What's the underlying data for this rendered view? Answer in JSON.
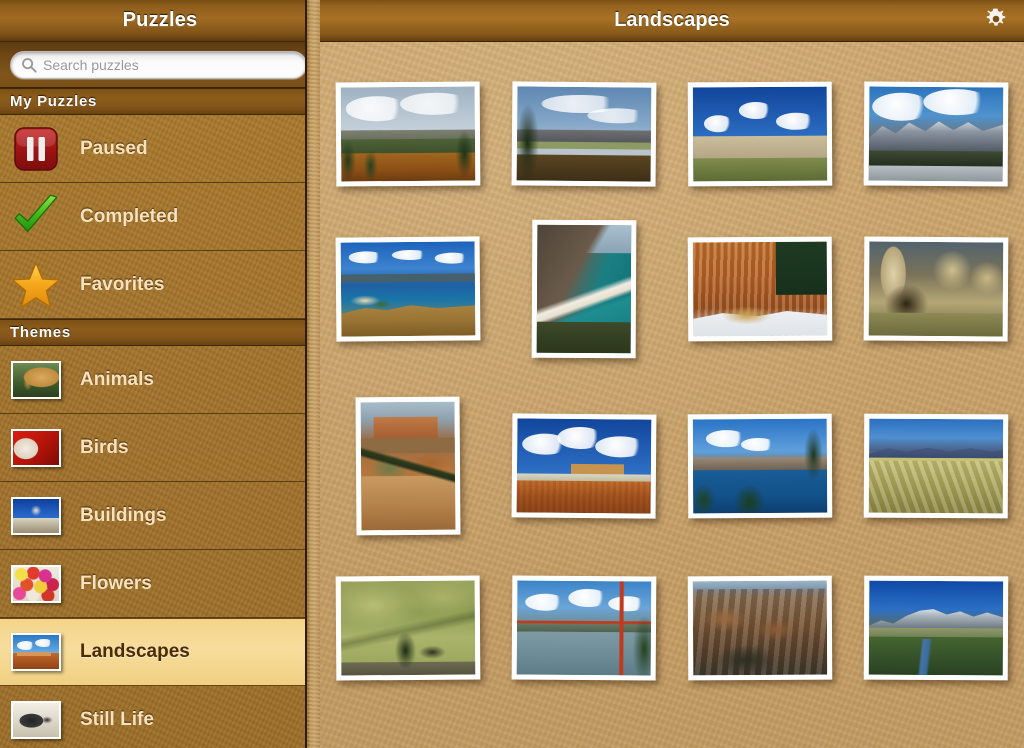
{
  "sidebar": {
    "title": "Puzzles",
    "search": {
      "placeholder": "Search puzzles",
      "value": "",
      "icon": "search-icon"
    },
    "sections": [
      {
        "header": "My Puzzles",
        "items": [
          {
            "label": "Paused",
            "icon": "pause-icon",
            "selected": false
          },
          {
            "label": "Completed",
            "icon": "checkmark-icon",
            "selected": false
          },
          {
            "label": "Favorites",
            "icon": "star-icon",
            "selected": false
          }
        ]
      },
      {
        "header": "Themes",
        "items": [
          {
            "label": "Animals",
            "icon": "thumbnail-giraffe",
            "selected": false
          },
          {
            "label": "Birds",
            "icon": "thumbnail-parrot",
            "selected": false
          },
          {
            "label": "Buildings",
            "icon": "thumbnail-building",
            "selected": false
          },
          {
            "label": "Flowers",
            "icon": "thumbnail-flowers",
            "selected": false
          },
          {
            "label": "Landscapes",
            "icon": "thumbnail-mesa",
            "selected": true
          },
          {
            "label": "Still Life",
            "icon": "thumbnail-fish",
            "selected": false
          }
        ]
      }
    ]
  },
  "main": {
    "title": "Landscapes",
    "settings_button": {
      "icon": "gear-icon",
      "label": "Settings"
    },
    "grid": {
      "rows": [
        [
          {
            "name": "autumn-valley-conifers",
            "orientation": "landscape"
          },
          {
            "name": "river-valley-mountains",
            "orientation": "landscape"
          },
          {
            "name": "badlands-blue-sky",
            "orientation": "landscape"
          },
          {
            "name": "snow-peaks-alpine-lake",
            "orientation": "landscape"
          }
        ],
        [
          {
            "name": "island-bay-aerial",
            "orientation": "landscape"
          },
          {
            "name": "coastal-cliffs-beach",
            "orientation": "portrait"
          },
          {
            "name": "bryce-canyon-hoodoos",
            "orientation": "landscape"
          },
          {
            "name": "desert-rock-spires",
            "orientation": "landscape"
          }
        ],
        [
          {
            "name": "canyon-mesa-tree",
            "orientation": "portrait"
          },
          {
            "name": "red-butte-clouds",
            "orientation": "landscape"
          },
          {
            "name": "crater-lake",
            "orientation": "landscape"
          },
          {
            "name": "badlands-ridge-range",
            "orientation": "landscape"
          }
        ],
        [
          {
            "name": "green-rolling-hills",
            "orientation": "landscape"
          },
          {
            "name": "golden-gate-bridge",
            "orientation": "landscape"
          },
          {
            "name": "grand-canyon-layers",
            "orientation": "landscape"
          },
          {
            "name": "grand-tetons-river",
            "orientation": "landscape"
          }
        ]
      ]
    }
  },
  "colors": {
    "sidebar_bg": "#a2722a",
    "main_bg": "#c9a36b",
    "titlebar": "#a87125",
    "selection": "#f3d489",
    "label_text": "#f6e2bd",
    "selected_text": "#4a2c0b"
  }
}
